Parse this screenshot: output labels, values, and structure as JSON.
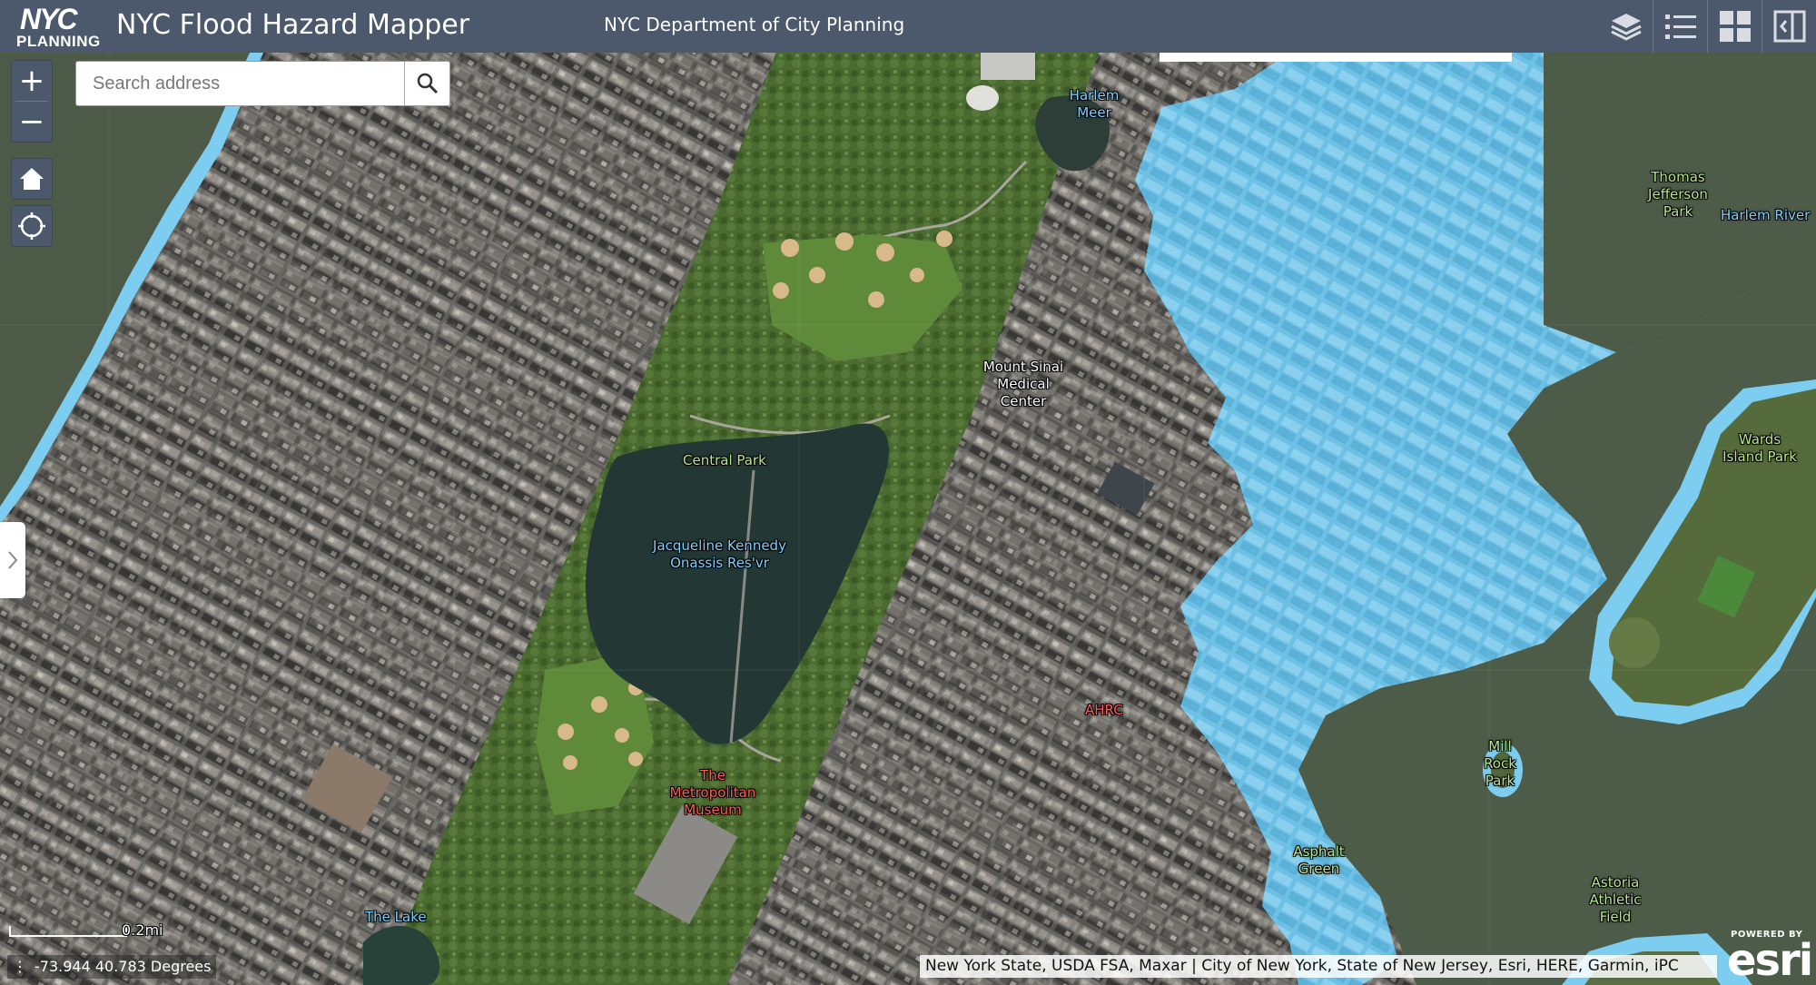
{
  "header": {
    "logo_top": "NYC",
    "logo_bottom": "PLANNING",
    "app_title": "NYC Flood Hazard Mapper",
    "subtitle": "NYC Department of City Planning",
    "buttons": [
      {
        "icon": "layers-icon"
      },
      {
        "icon": "legend-list-icon"
      },
      {
        "icon": "basemap-gallery-icon"
      },
      {
        "icon": "panel-toggle-icon"
      }
    ]
  },
  "search": {
    "placeholder": "Search address"
  },
  "controls": {
    "zoom_in": "+",
    "zoom_out": "−",
    "home_icon": "home-icon",
    "locate_icon": "locate-icon"
  },
  "labels": {
    "harlem_meer": "Harlem Meer",
    "thomas_jefferson_park": "Thomas Jefferson Park",
    "harlem_river": "Harlem River",
    "mount_sinai": "Mount Sinai Medical Center",
    "central_park": "Central Park",
    "reservoir": "Jacqueline Kennedy Onassis Res'vr",
    "wards_island_park": "Wards Island Park",
    "ahrc": "AHRC",
    "mill_rock_park": "Mill Rock Park",
    "the_met": "The Metropolitan Museum",
    "asphalt_green": "Asphalt Green",
    "astoria_athletic_field": "Astoria Athletic Field",
    "the_lake": "The Lake"
  },
  "scale": {
    "label": "0.2mi"
  },
  "coordinates": {
    "text": "-73.944 40.783 Degrees"
  },
  "attribution": "New York State, USDA FSA, Maxar | City of New York, State of New Jersey, Esri, HERE, Garmin, iPC",
  "esri": {
    "powered_by": "POWERED BY",
    "brand": "esri"
  },
  "colors": {
    "header_bg": "#4c596c",
    "flood_zone": "#7ccdf0",
    "water": "#4f5e4c",
    "park": "#4f6b35"
  }
}
